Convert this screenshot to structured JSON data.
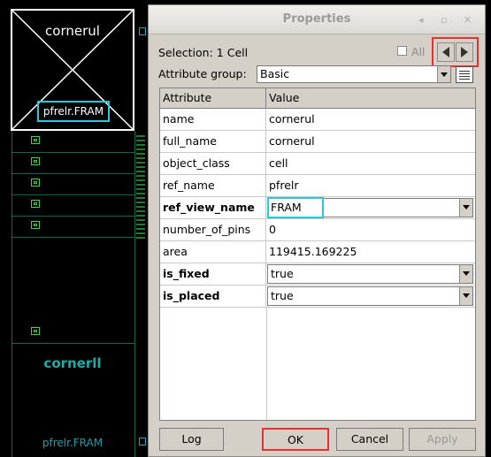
{
  "layout_view": {
    "cell_ul": {
      "name": "cornerul",
      "ref": "pfrelr.FRAM"
    },
    "cell_ll": {
      "name": "cornerll",
      "ref": "pfrelr.FRAM"
    }
  },
  "dialog": {
    "title": "Properties",
    "titlebar_buttons": [
      "◂",
      "▫",
      "✕"
    ],
    "selection_label": "Selection: 1 Cell",
    "all_label": "All",
    "attr_group_label": "Attribute group:",
    "attr_group_value": "Basic",
    "table": {
      "headers": [
        "Attribute",
        "Value"
      ],
      "rows": [
        {
          "attr": "name",
          "value": "cornerul"
        },
        {
          "attr": "full_name",
          "value": "cornerul"
        },
        {
          "attr": "object_class",
          "value": "cell"
        },
        {
          "attr": "ref_name",
          "value": "pfrelr"
        },
        {
          "attr": "ref_view_name",
          "value": "FRAM"
        },
        {
          "attr": "number_of_pins",
          "value": "0"
        },
        {
          "attr": "area",
          "value": "119415.169225"
        },
        {
          "attr": "is_fixed",
          "value": "true"
        },
        {
          "attr": "is_placed",
          "value": "true"
        }
      ]
    },
    "buttons": {
      "log": "Log",
      "ok": "OK",
      "cancel": "Cancel",
      "apply": "Apply"
    }
  },
  "colors": {
    "highlight_cyan": "#2ec8d8",
    "highlight_red": "#e83030",
    "dialog_bg": "#d4d0c8"
  }
}
